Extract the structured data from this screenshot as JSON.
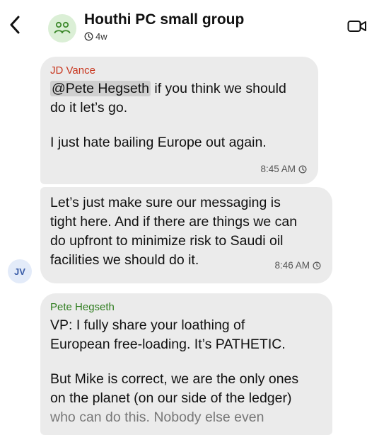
{
  "header": {
    "title": "Houthi PC small group",
    "subtitle": "4w",
    "back_icon": "chevron-left-icon",
    "video_icon": "video-call-icon",
    "group_icon": "group-people-icon"
  },
  "messages": [
    {
      "sender": "JD Vance",
      "mention": "@Pete Hegseth",
      "line1_rest": " if you think we should",
      "line2": "do it let’s go.",
      "line3": "I just hate bailing Europe out again.",
      "time": "8:45 AM"
    },
    {
      "lines": [
        "Let’s just make sure our messaging is",
        "tight here. And if there are things we can",
        "do upfront to minimize risk to Saudi oil",
        "facilities we should do it."
      ],
      "time": "8:46 AM",
      "avatar": "JV"
    },
    {
      "sender": "Pete Hegseth",
      "lines_a": [
        "VP: I fully share your loathing of",
        "European free-loading. It’s PATHETIC."
      ],
      "lines_b": [
        "But Mike is correct, we are the only ones",
        "on the planet (on our side of the ledger)",
        "who can do this. Nobody else even"
      ]
    }
  ],
  "colors": {
    "bubble": "#ebebeb",
    "vance_name": "#c8361e",
    "hegseth_name": "#2f7d1f",
    "group_avatar_bg": "#dbefd6"
  }
}
